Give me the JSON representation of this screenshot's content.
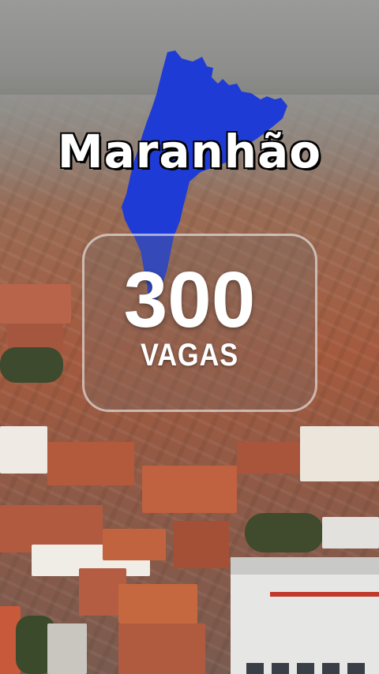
{
  "region": {
    "name": "Maranhão",
    "map_color": "#1f3bd6"
  },
  "highlight": {
    "number": "300",
    "label": "VAGAS"
  },
  "background": {
    "sky_color": "#8f908e",
    "roof_color": "#b5634a"
  }
}
